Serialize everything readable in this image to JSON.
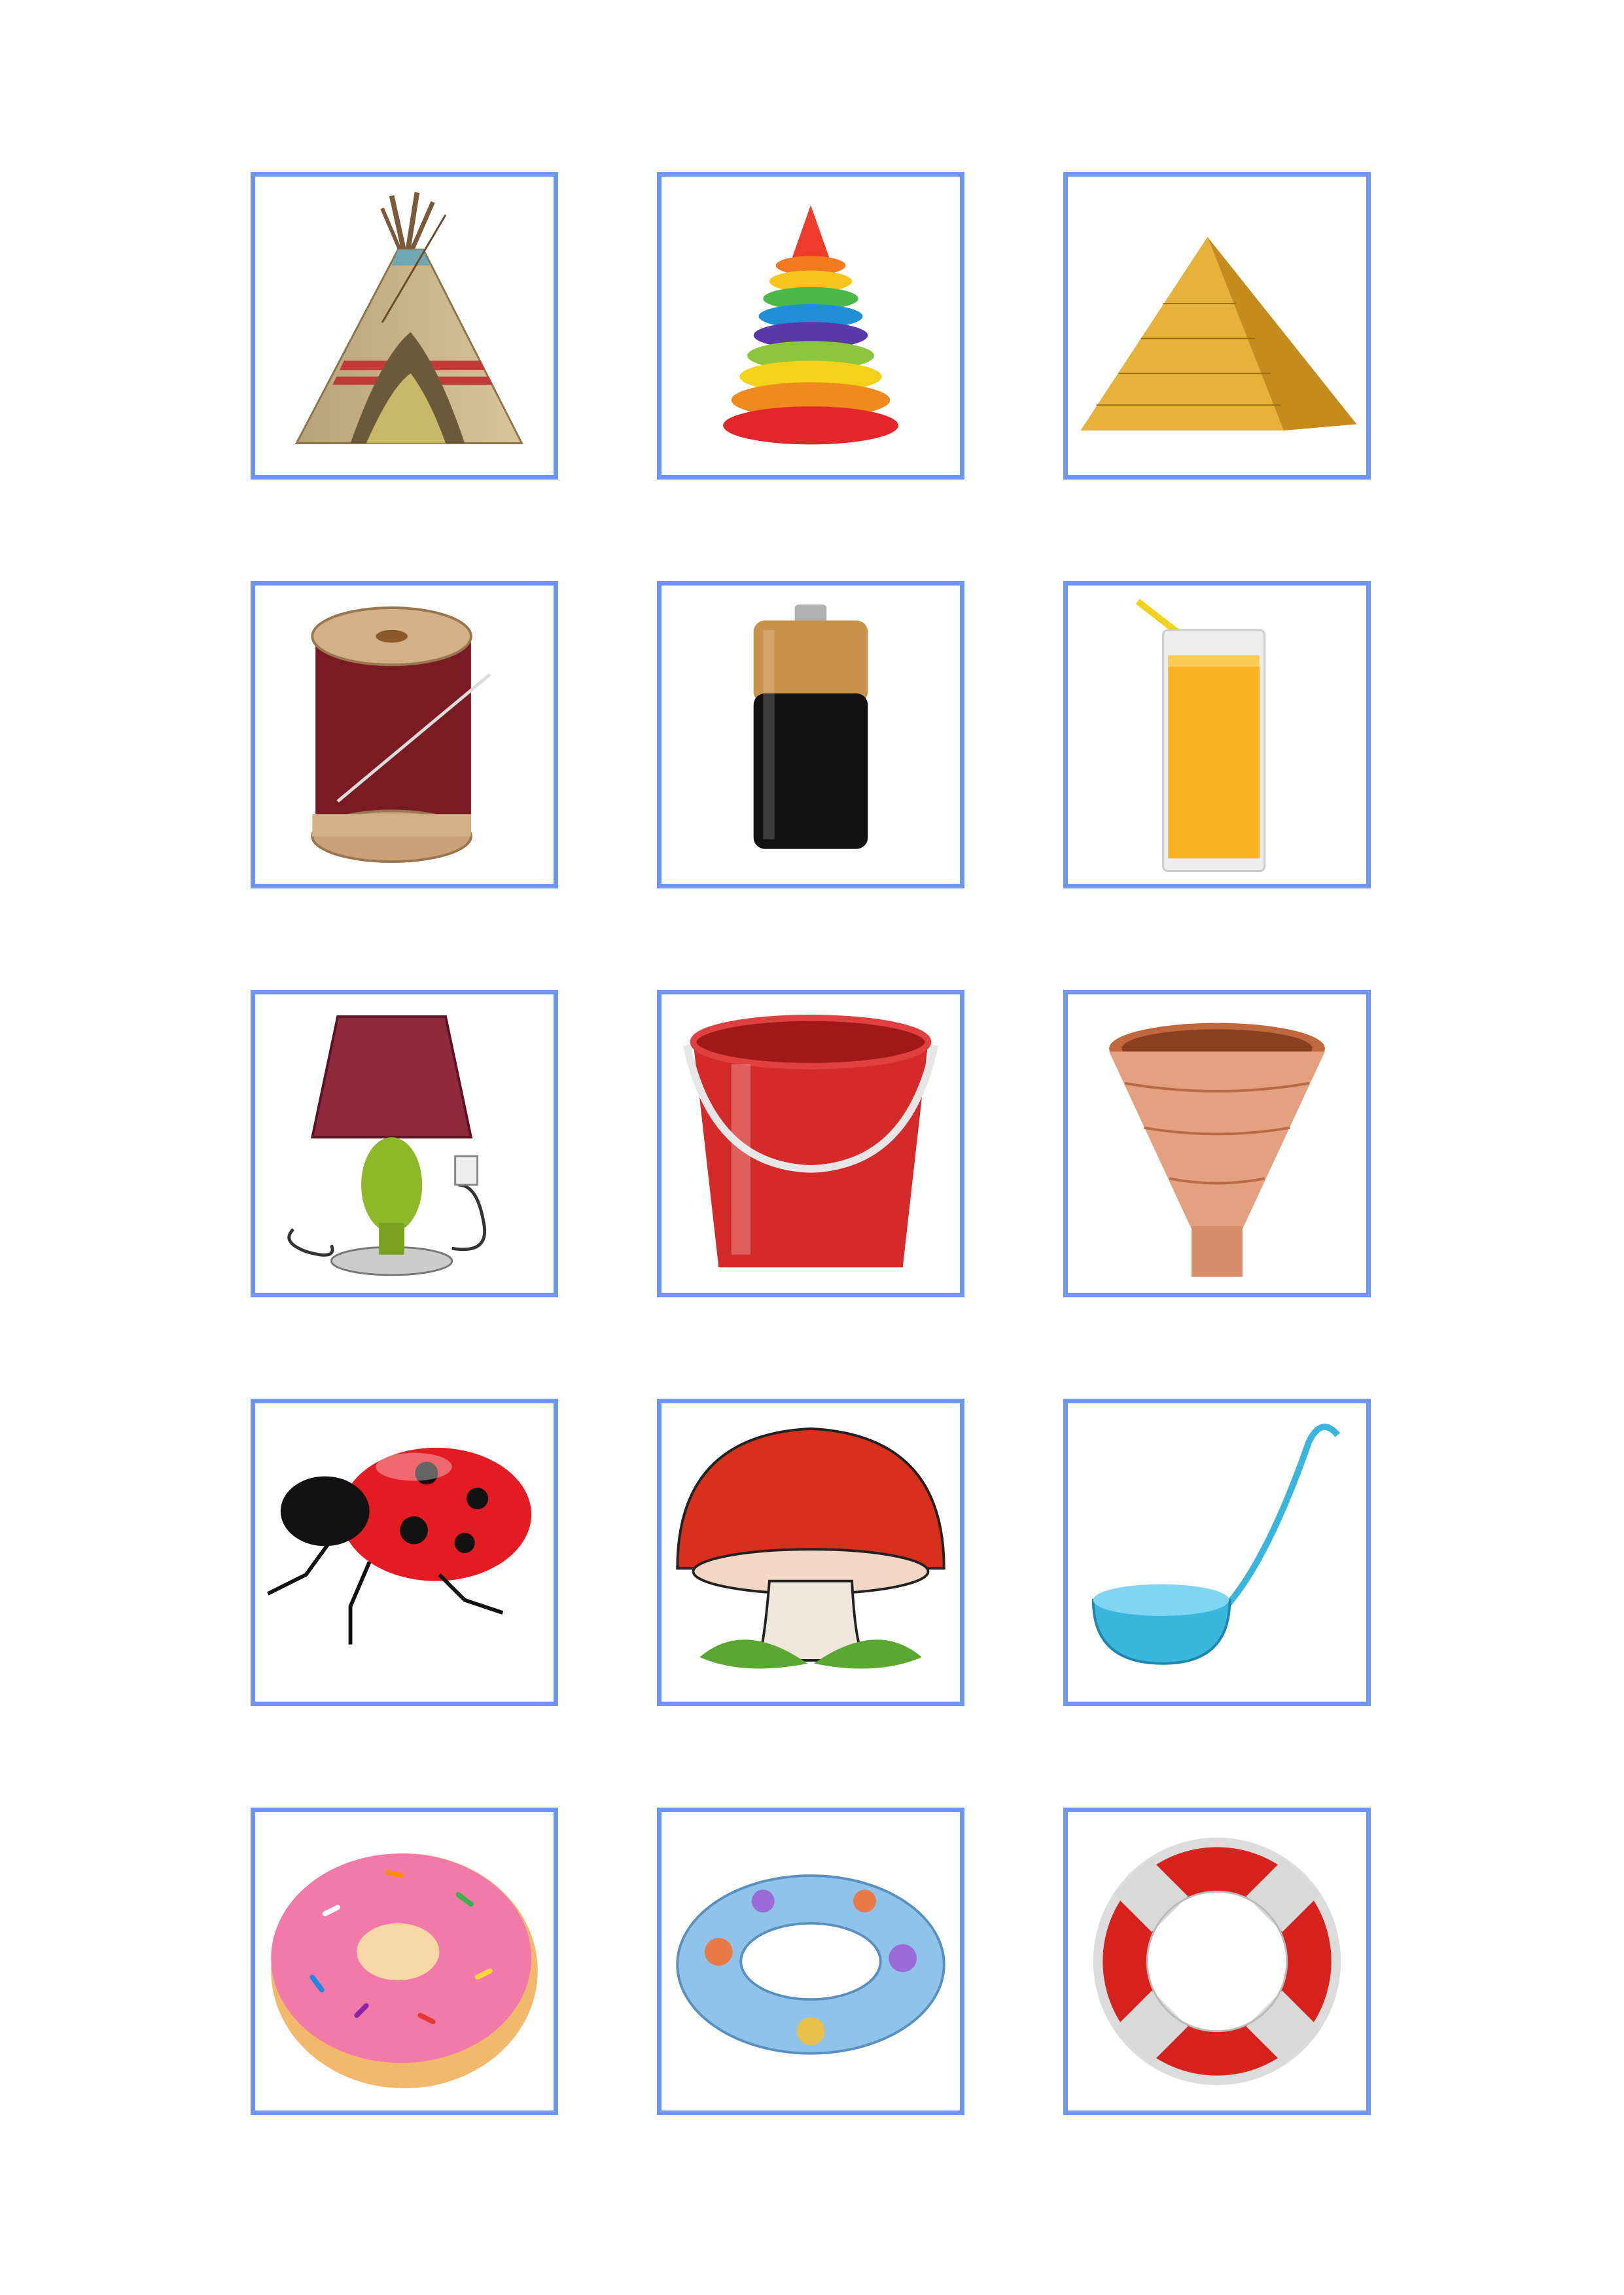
{
  "colors": {
    "card_border": "#6d96f2",
    "background": "#ffffff"
  },
  "cards": [
    {
      "icon": "teepee-icon"
    },
    {
      "icon": "stacking-rings-toy-icon"
    },
    {
      "icon": "pyramid-icon"
    },
    {
      "icon": "thread-spool-icon"
    },
    {
      "icon": "battery-icon"
    },
    {
      "icon": "juice-glass-icon"
    },
    {
      "icon": "table-lamp-icon"
    },
    {
      "icon": "bucket-icon"
    },
    {
      "icon": "funnel-icon"
    },
    {
      "icon": "ladybug-icon"
    },
    {
      "icon": "mushroom-icon"
    },
    {
      "icon": "ladle-icon"
    },
    {
      "icon": "donut-icon"
    },
    {
      "icon": "swim-ring-icon"
    },
    {
      "icon": "lifebuoy-icon"
    }
  ]
}
